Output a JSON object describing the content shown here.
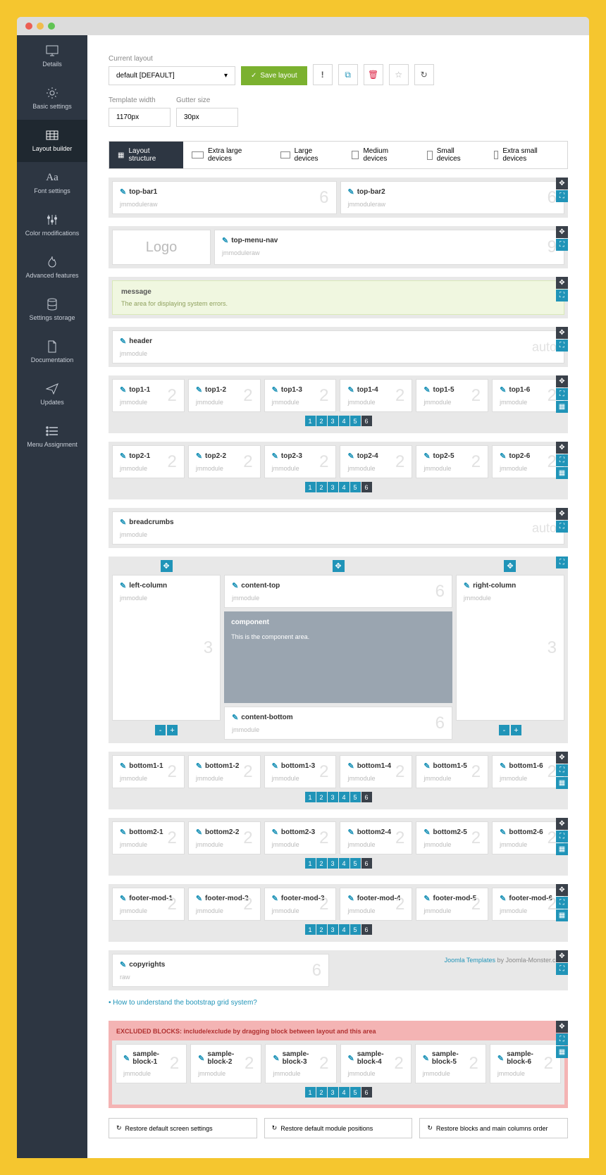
{
  "sidebar": {
    "items": [
      {
        "label": "Details"
      },
      {
        "label": "Basic settings"
      },
      {
        "label": "Layout builder"
      },
      {
        "label": "Font settings"
      },
      {
        "label": "Color modifications"
      },
      {
        "label": "Advanced features"
      },
      {
        "label": "Settings storage"
      },
      {
        "label": "Documentation"
      },
      {
        "label": "Updates"
      },
      {
        "label": "Menu Assignment"
      }
    ]
  },
  "header": {
    "current_layout_label": "Current layout",
    "current_layout_value": "default [DEFAULT]",
    "save_label": "Save layout",
    "template_width_label": "Template width",
    "template_width_value": "1170px",
    "gutter_label": "Gutter size",
    "gutter_value": "30px"
  },
  "tabs": {
    "layout_structure": "Layout structure",
    "xl": "Extra large devices",
    "lg": "Large devices",
    "md": "Medium devices",
    "sm": "Small devices",
    "xs": "Extra small devices"
  },
  "blocks": {
    "topbar1": {
      "name": "top-bar1",
      "sub": "jmmoduleraw",
      "num": "6"
    },
    "topbar2": {
      "name": "top-bar2",
      "sub": "jmmoduleraw",
      "num": "6"
    },
    "logo": "Logo",
    "topmenu": {
      "name": "top-menu-nav",
      "sub": "jmmoduleraw",
      "num": "9"
    },
    "message": {
      "name": "message",
      "desc": "The area for displaying system errors."
    },
    "headerb": {
      "name": "header",
      "sub": "jmmodule",
      "num": "auto"
    },
    "top1": [
      {
        "n": "top1-1"
      },
      {
        "n": "top1-2"
      },
      {
        "n": "top1-3"
      },
      {
        "n": "top1-4"
      },
      {
        "n": "top1-5"
      },
      {
        "n": "top1-6"
      }
    ],
    "top2": [
      {
        "n": "top2-1"
      },
      {
        "n": "top2-2"
      },
      {
        "n": "top2-3"
      },
      {
        "n": "top2-4"
      },
      {
        "n": "top2-5"
      },
      {
        "n": "top2-6"
      }
    ],
    "breadcrumbs": {
      "name": "breadcrumbs",
      "sub": "jmmodule",
      "num": "auto"
    },
    "leftcol": {
      "name": "left-column",
      "sub": "jmmodule",
      "num": "3"
    },
    "contenttop": {
      "name": "content-top",
      "sub": "jmmodule",
      "num": "6"
    },
    "rightcol": {
      "name": "right-column",
      "sub": "jmmodule",
      "num": "3"
    },
    "component": {
      "name": "component",
      "desc": "This is the component area."
    },
    "contentbottom": {
      "name": "content-bottom",
      "sub": "jmmodule",
      "num": "6"
    },
    "bottom1": [
      {
        "n": "bottom1-1"
      },
      {
        "n": "bottom1-2"
      },
      {
        "n": "bottom1-3"
      },
      {
        "n": "bottom1-4"
      },
      {
        "n": "bottom1-5"
      },
      {
        "n": "bottom1-6"
      }
    ],
    "bottom2": [
      {
        "n": "bottom2-1"
      },
      {
        "n": "bottom2-2"
      },
      {
        "n": "bottom2-3"
      },
      {
        "n": "bottom2-4"
      },
      {
        "n": "bottom2-5"
      },
      {
        "n": "bottom2-6"
      }
    ],
    "footermod": [
      {
        "n": "footer-mod-1"
      },
      {
        "n": "footer-mod-2"
      },
      {
        "n": "footer-mod-3"
      },
      {
        "n": "footer-mod-4"
      },
      {
        "n": "footer-mod-5"
      },
      {
        "n": "footer-mod-6"
      }
    ],
    "copyright": {
      "name": "copyrights",
      "sub": "raw",
      "num": "6"
    },
    "credit_link": "Joomla Templates",
    "credit_text": " by Joomla-Monster.com",
    "sample": [
      {
        "n": "sample-block-1"
      },
      {
        "n": "sample-block-2"
      },
      {
        "n": "sample-block-3"
      },
      {
        "n": "sample-block-4"
      },
      {
        "n": "sample-block-5"
      },
      {
        "n": "sample-block-6"
      }
    ],
    "jmmodule": "jmmodule",
    "two": "2",
    "pages": [
      "1",
      "2",
      "3",
      "4",
      "5",
      "6"
    ]
  },
  "link_grid": "How to understand the bootstrap grid system?",
  "excluded_header": "EXCLUDED BLOCKS: include/exclude by dragging block between layout and this area",
  "restore": {
    "screen": "Restore default screen settings",
    "module": "Restore default module positions",
    "blocks": "Restore blocks and main columns order"
  }
}
